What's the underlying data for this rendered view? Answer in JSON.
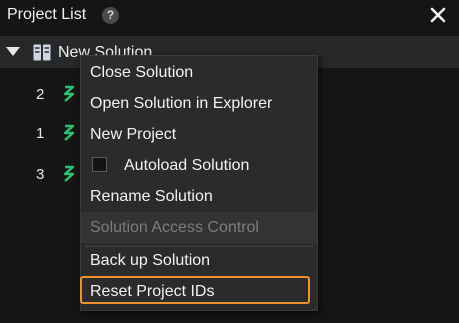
{
  "panel": {
    "title": "Project List",
    "help_icon": "question-circle-icon",
    "help_glyph": "?",
    "close_icon": "close-icon"
  },
  "tree": {
    "root_label": "New Solution",
    "root_icon": "solution-icon",
    "projects": [
      {
        "number": "2",
        "icon": "project-icon"
      },
      {
        "number": "1",
        "icon": "project-icon"
      },
      {
        "number": "3",
        "icon": "project-icon"
      }
    ]
  },
  "context_menu": {
    "items": [
      {
        "label": "Close Solution",
        "enabled": true
      },
      {
        "label": "Open Solution in Explorer",
        "enabled": true
      },
      {
        "label": "New Project",
        "enabled": true
      },
      {
        "label": "Autoload Solution",
        "enabled": true,
        "checkbox": true,
        "checked": false
      },
      {
        "label": "Rename Solution",
        "enabled": true
      },
      {
        "label": "Solution Access Control",
        "enabled": false
      },
      {
        "label": "Back up Solution",
        "enabled": true
      },
      {
        "label": "Reset Project IDs",
        "enabled": true,
        "highlighted": true
      }
    ]
  },
  "colors": {
    "background": "#151515",
    "selected_row": "#262829",
    "menu_background": "#2b2b2b",
    "disabled_text": "#7c7c7c",
    "highlight_outline": "#f0922a",
    "project_icon_green": "#2fbf71"
  }
}
